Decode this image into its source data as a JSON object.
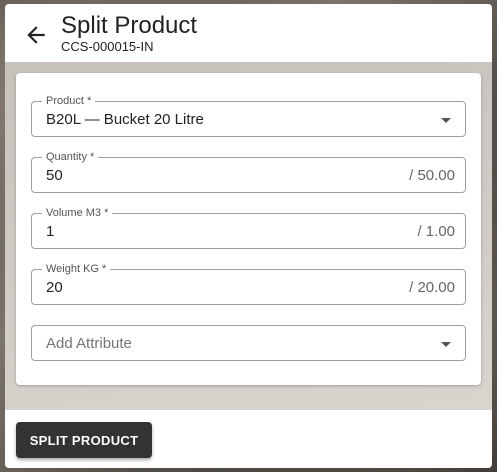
{
  "dialog": {
    "title": "Split Product",
    "subtitle": "CCS-000015-IN",
    "back_icon": "arrow-left-icon"
  },
  "form": {
    "product": {
      "label": "Product *",
      "value": "B20L — Bucket 20 Litre"
    },
    "quantity": {
      "label": "Quantity *",
      "value": "50",
      "suffix": "/ 50.00"
    },
    "volume": {
      "label": "Volume M3 *",
      "value": "1",
      "suffix": "/ 1.00"
    },
    "weight": {
      "label": "Weight KG *",
      "value": "20",
      "suffix": "/ 20.00"
    },
    "attribute": {
      "placeholder": "Add Attribute"
    }
  },
  "footer": {
    "split_label": "SPLIT PRODUCT"
  },
  "colors": {
    "primary_button": "#333333",
    "outline": "#9e9e9e"
  }
}
